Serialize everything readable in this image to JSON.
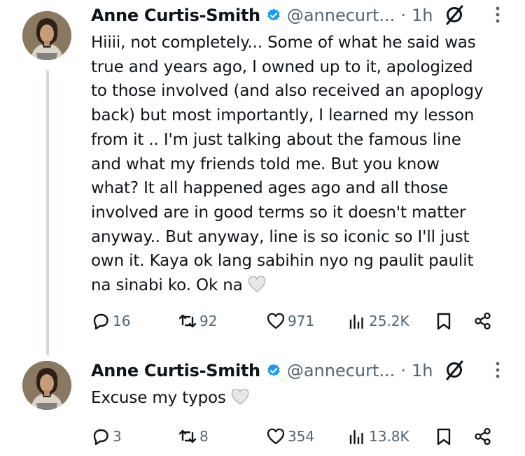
{
  "tweets": [
    {
      "author_name": "Anne Curtis-Smith",
      "handle": "@annecurt...",
      "separator": "·",
      "time": "1h",
      "text": "Hiiii, not completely... Some of what he said was\ntrue and years ago, I owned up to it, apologized\nto those involved (and also received an apoplogy\nback) but most importantly, I learned my lesson\nfrom it .. I'm just talking about the famous line\nand what my friends told me. But you know\nwhat? It all happened ages ago and all those\ninvolved are in good terms so it doesn't matter\nanyway.. But anyway, line is so iconic so I'll just\nown it. Kaya ok lang sabihin nyo ng paulit paulit\nna sinabi ko. Ok na",
      "emoji": "grey-heart",
      "replies": "16",
      "reposts": "92",
      "likes": "971",
      "views": "25.2K"
    },
    {
      "author_name": "Anne Curtis-Smith",
      "handle": "@annecurt...",
      "separator": "·",
      "time": "1h",
      "text": "Excuse my typos",
      "emoji": "grey-heart",
      "replies": "3",
      "reposts": "8",
      "likes": "354",
      "views": "13.8K"
    }
  ],
  "colors": {
    "verified": "#1d9bf0",
    "muted": "#536471",
    "thread_line": "#cfd9de"
  }
}
